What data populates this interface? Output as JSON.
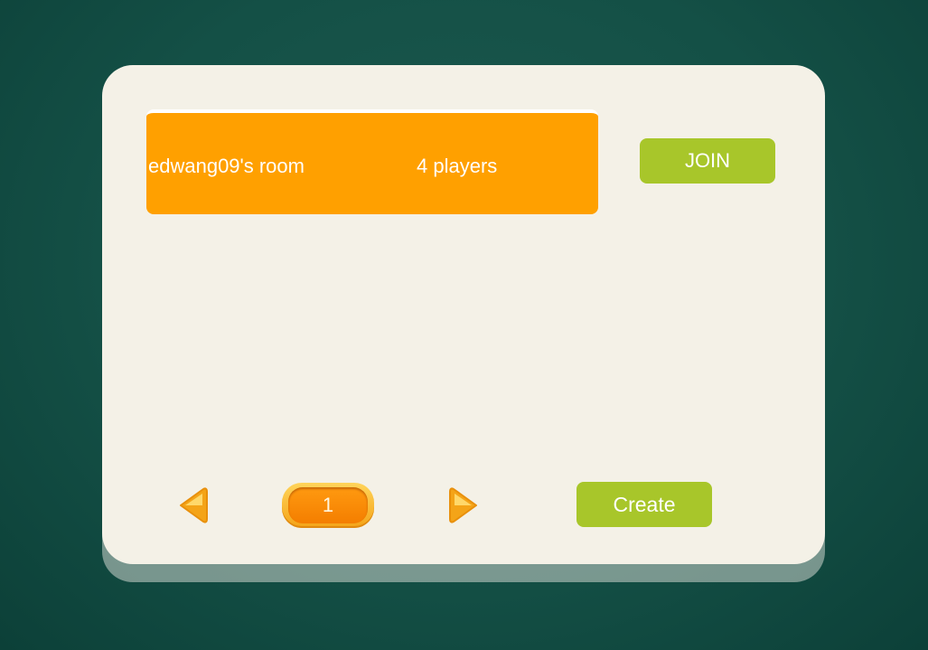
{
  "rooms": [
    {
      "name": "edwang09's room",
      "players": "4 players",
      "join_label": "JOIN"
    }
  ],
  "pagination": {
    "current_page": "1",
    "prev_icon": "triangle-left-icon",
    "next_icon": "triangle-right-icon"
  },
  "actions": {
    "create_label": "Create"
  },
  "colors": {
    "background": "#145046",
    "panel": "#f4f1e7",
    "room_row": "#ffa000",
    "button_green": "#a8c62a",
    "arrow_gold": "#f4b21a"
  }
}
